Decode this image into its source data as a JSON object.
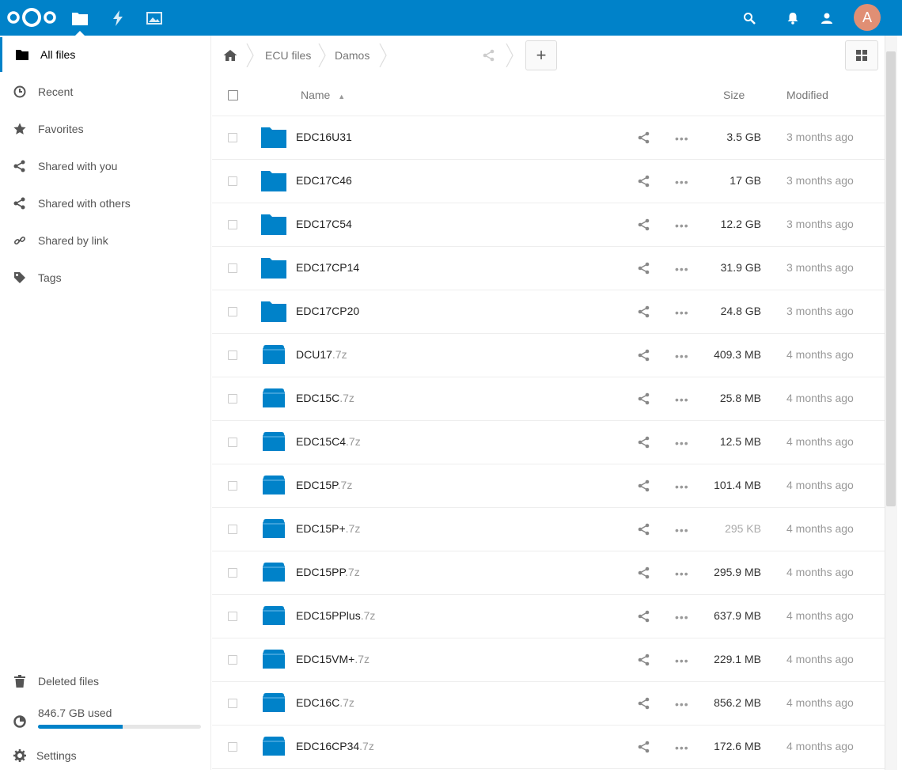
{
  "header": {
    "apps": [
      {
        "name": "files-icon",
        "active": true
      },
      {
        "name": "activity-icon",
        "active": false
      },
      {
        "name": "gallery-icon",
        "active": false
      }
    ],
    "avatar_letter": "A",
    "right_icons": [
      "search-icon",
      "notifications-icon",
      "contacts-icon"
    ]
  },
  "sidebar": {
    "items": [
      {
        "label": "All files",
        "icon": "folder-icon"
      },
      {
        "label": "Recent",
        "icon": "clock-icon"
      },
      {
        "label": "Favorites",
        "icon": "star-icon"
      },
      {
        "label": "Shared with you",
        "icon": "share-icon"
      },
      {
        "label": "Shared with others",
        "icon": "share-icon"
      },
      {
        "label": "Shared by link",
        "icon": "link-icon"
      },
      {
        "label": "Tags",
        "icon": "tag-icon"
      }
    ],
    "deleted": "Deleted files",
    "quota_label": "846.7 GB used",
    "quota_fraction": 0.52,
    "settings": "Settings"
  },
  "breadcrumb": {
    "items": [
      "ECU files",
      "Damos"
    ]
  },
  "table": {
    "col_name": "Name",
    "col_size": "Size",
    "col_modified": "Modified",
    "rows": [
      {
        "name": "EDC16U31",
        "ext": "",
        "type": "folder",
        "size": "3.5 GB",
        "modified": "3 months ago"
      },
      {
        "name": "EDC17C46",
        "ext": "",
        "type": "folder",
        "size": "17 GB",
        "modified": "3 months ago"
      },
      {
        "name": "EDC17C54",
        "ext": "",
        "type": "folder",
        "size": "12.2 GB",
        "modified": "3 months ago"
      },
      {
        "name": "EDC17CP14",
        "ext": "",
        "type": "folder",
        "size": "31.9 GB",
        "modified": "3 months ago"
      },
      {
        "name": "EDC17CP20",
        "ext": "",
        "type": "folder",
        "size": "24.8 GB",
        "modified": "3 months ago"
      },
      {
        "name": "DCU17",
        "ext": ".7z",
        "type": "archive",
        "size": "409.3 MB",
        "modified": "4 months ago"
      },
      {
        "name": "EDC15C",
        "ext": ".7z",
        "type": "archive",
        "size": "25.8 MB",
        "modified": "4 months ago"
      },
      {
        "name": "EDC15C4",
        "ext": ".7z",
        "type": "archive",
        "size": "12.5 MB",
        "modified": "4 months ago"
      },
      {
        "name": "EDC15P",
        "ext": ".7z",
        "type": "archive",
        "size": "101.4 MB",
        "modified": "4 months ago"
      },
      {
        "name": "EDC15P+",
        "ext": ".7z",
        "type": "archive",
        "size": "295 KB",
        "modified": "4 months ago"
      },
      {
        "name": "EDC15PP",
        "ext": ".7z",
        "type": "archive",
        "size": "295.9 MB",
        "modified": "4 months ago"
      },
      {
        "name": "EDC15PPlus",
        "ext": ".7z",
        "type": "archive",
        "size": "637.9 MB",
        "modified": "4 months ago"
      },
      {
        "name": "EDC15VM+",
        "ext": ".7z",
        "type": "archive",
        "size": "229.1 MB",
        "modified": "4 months ago"
      },
      {
        "name": "EDC16C",
        "ext": ".7z",
        "type": "archive",
        "size": "856.2 MB",
        "modified": "4 months ago"
      },
      {
        "name": "EDC16CP34",
        "ext": ".7z",
        "type": "archive",
        "size": "172.6 MB",
        "modified": "4 months ago"
      }
    ]
  },
  "colors": {
    "brand": "#0082c9",
    "folder": "#0082c9"
  }
}
